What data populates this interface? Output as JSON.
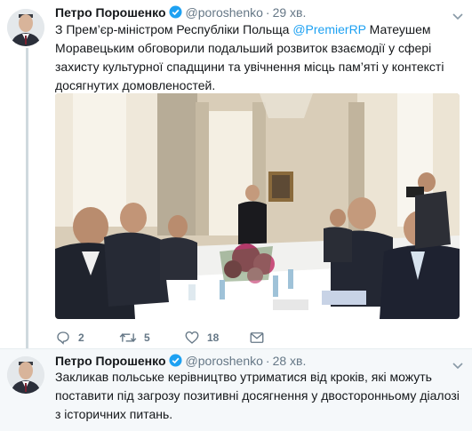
{
  "tweets": [
    {
      "author_name": "Петро Порошенко",
      "handle": "@poroshenko",
      "separator": "·",
      "time": "29 хв.",
      "text_before": "З Прем’єр-міністром Республіки Польща ",
      "mention": "@PremierRP",
      "text_after": " Матеушем Моравецьким обговорили подальший розвиток взаємодії у сфері захисту культурної спадщини та  увічнення місць пам’яті у контексті досягнутих домовленостей.",
      "actions": {
        "reply_count": "2",
        "retweet_count": "5",
        "like_count": "18"
      }
    },
    {
      "author_name": "Петро Порошенко",
      "handle": "@poroshenko",
      "separator": "·",
      "time": "28 хв.",
      "text": "Закликав польське керівництво утриматися від кроків, які можуть  поставити під загрозу позитивні досягнення у двосторонньому діалозі з  історичних питань."
    }
  ],
  "icons": {
    "verified": "verified-badge-icon",
    "caret": "chevron-down-icon",
    "reply": "reply-icon",
    "retweet": "retweet-icon",
    "like": "heart-icon",
    "message": "direct-message-icon"
  },
  "colors": {
    "link": "#1da1f2",
    "secondary_text": "#657786",
    "thread_line": "#cfd9de"
  }
}
